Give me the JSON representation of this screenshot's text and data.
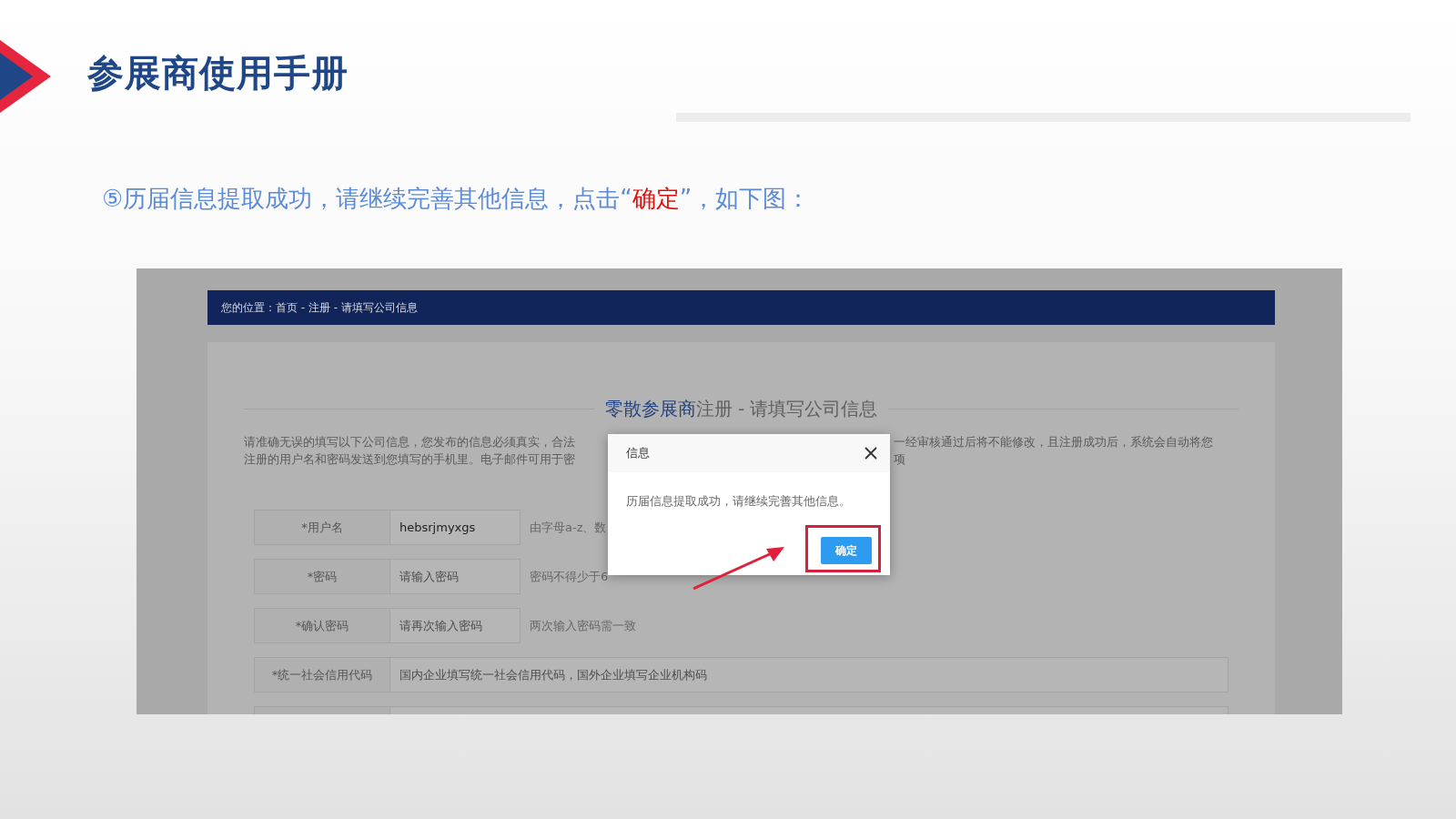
{
  "header": {
    "title": "参展商使用手册"
  },
  "instruction": {
    "parts": [
      {
        "text": "⑤历届信息提取成功，请继续完善其他信息，点击“",
        "highlight": false
      },
      {
        "text": "确定",
        "highlight": true
      },
      {
        "text": "”，如下图：",
        "highlight": false
      }
    ]
  },
  "screenshot": {
    "breadcrumb": "您的位置：首页 - 注册 - 请填写公司信息",
    "heading": {
      "accent": "零散参展商",
      "rest": "注册 - 请填写公司信息"
    },
    "intro_lines": [
      {
        "left": "请准确无误的填写以下公司信息，您发布的信息必须真实，合法",
        "right": "一经审核通过后将不能修改，且注册成功后，系统会自动将您"
      },
      {
        "left": "注册的用户名和密码发送到您填写的手机里。电子邮件可用于密",
        "right": "项"
      }
    ],
    "form_rows": [
      {
        "kind": "short",
        "label": "*用户名",
        "value": "hebsrjmyxgs",
        "hint": "由字母a-z、数"
      },
      {
        "kind": "short",
        "label": "*密码",
        "placeholder": "请输入密码",
        "hint": "密码不得少于6"
      },
      {
        "kind": "short",
        "label": "*确认密码",
        "placeholder": "请再次输入密码",
        "hint": "两次输入密码需一致"
      },
      {
        "kind": "wide",
        "label": "*统一社会信用代码",
        "placeholder": "国内企业填写统一社会信用代码，国外企业填写企业机构码"
      },
      {
        "kind": "blank"
      }
    ],
    "dialog": {
      "title": "信息",
      "message": "历届信息提取成功，请继续完善其他信息。",
      "button": "确定"
    }
  }
}
